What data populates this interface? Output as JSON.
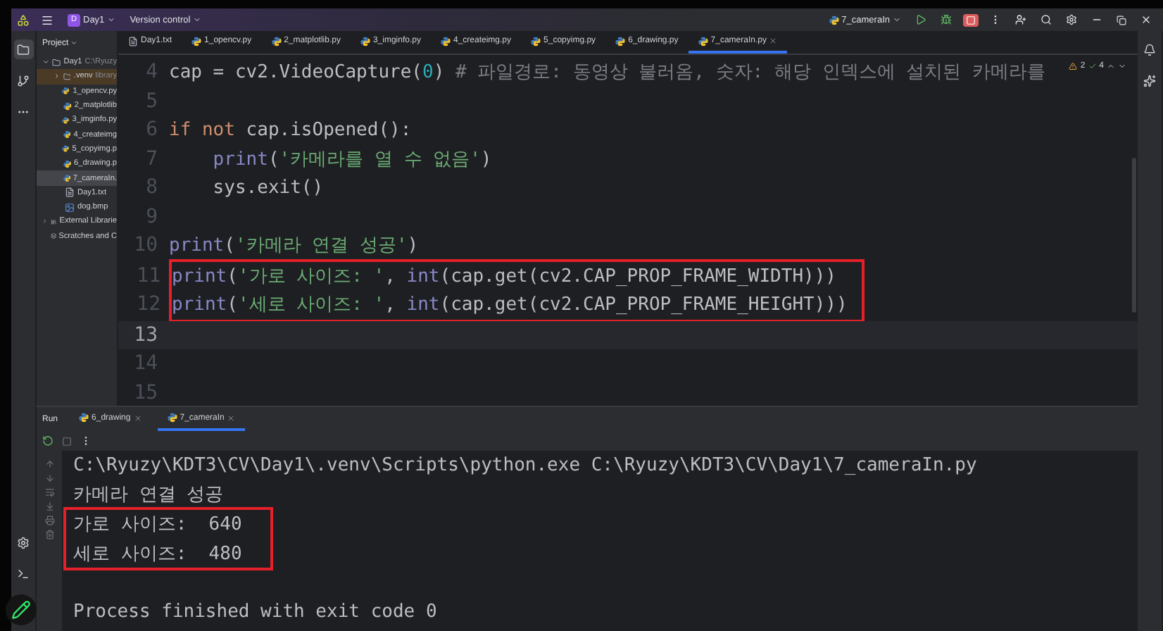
{
  "title_bar": {
    "project_badge": "D",
    "project": "Day1",
    "vcs": "Version control",
    "run_config": "7_cameraIn"
  },
  "project_panel": {
    "title": "Project",
    "tree": [
      {
        "label": "Day1",
        "note": "C:\\Ryuzy",
        "kind": "folder",
        "expanded": true,
        "selected": false,
        "excluded": false,
        "children": [
          {
            "label": ".venv",
            "note": "library",
            "kind": "folder",
            "expanded": false,
            "selected": false,
            "excluded": true
          },
          {
            "label": "1_opencv.py",
            "kind": "python",
            "selected": false,
            "excluded": false
          },
          {
            "label": "2_matplotlib",
            "kind": "python",
            "selected": false,
            "excluded": false
          },
          {
            "label": "3_imginfo.py",
            "kind": "python",
            "selected": false,
            "excluded": false
          },
          {
            "label": "4_createimg",
            "kind": "python",
            "selected": false,
            "excluded": false
          },
          {
            "label": "5_copyimg.p",
            "kind": "python",
            "selected": false,
            "excluded": false
          },
          {
            "label": "6_drawing.p",
            "kind": "python",
            "selected": false,
            "excluded": false
          },
          {
            "label": "7_cameraIn.",
            "kind": "python",
            "selected": true,
            "excluded": false
          },
          {
            "label": "Day1.txt",
            "kind": "text",
            "selected": false,
            "excluded": false
          },
          {
            "label": "dog.bmp",
            "kind": "image",
            "selected": false,
            "excluded": false
          }
        ]
      },
      {
        "label": "External Librarie",
        "kind": "library",
        "expanded": false,
        "selected": false,
        "excluded": false
      },
      {
        "label": "Scratches and C",
        "kind": "scratch",
        "selected": false,
        "excluded": false
      }
    ]
  },
  "editor_tabs": [
    {
      "label": "Day1.txt",
      "kind": "text",
      "selected": false
    },
    {
      "label": "1_opencv.py",
      "kind": "python",
      "selected": false
    },
    {
      "label": "2_matplotlib.py",
      "kind": "python",
      "selected": false
    },
    {
      "label": "3_imginfo.py",
      "kind": "python",
      "selected": false
    },
    {
      "label": "4_createimg.py",
      "kind": "python",
      "selected": false
    },
    {
      "label": "5_copyimg.py",
      "kind": "python",
      "selected": false
    },
    {
      "label": "6_drawing.py",
      "kind": "python",
      "selected": false
    },
    {
      "label": "7_cameraIn.py",
      "kind": "python",
      "selected": true
    }
  ],
  "inspections": {
    "warnings": "2",
    "weak_warnings": "4"
  },
  "code": [
    {
      "number": "4",
      "current": false,
      "boxed": false,
      "tokens": [
        {
          "kind": "plain",
          "text": "cap = cv2.VideoCapture("
        },
        {
          "kind": "number",
          "text": "0"
        },
        {
          "kind": "plain",
          "text": ")"
        },
        {
          "kind": "comment",
          "text": " # 파일경로: 동영상 불러옴, 숫자: 해당 인덱스에 설치된 카메라를"
        }
      ]
    },
    {
      "number": "5",
      "current": false,
      "boxed": false
    },
    {
      "number": "6",
      "current": false,
      "boxed": false,
      "tokens": [
        {
          "kind": "keyword",
          "text": "if not"
        },
        {
          "kind": "plain",
          "text": " cap.isOpened():"
        }
      ]
    },
    {
      "number": "7",
      "current": false,
      "boxed": false,
      "tokens": [
        {
          "kind": "builtin",
          "text": "    print"
        },
        {
          "kind": "plain",
          "text": "("
        },
        {
          "kind": "string",
          "text": "'카메라를 열 수 없음'"
        },
        {
          "kind": "plain",
          "text": ")"
        }
      ]
    },
    {
      "number": "8",
      "current": false,
      "boxed": false,
      "tokens": [
        {
          "kind": "plain",
          "text": "    sys.exit()"
        }
      ]
    },
    {
      "number": "9",
      "current": false,
      "boxed": false
    },
    {
      "number": "10",
      "current": false,
      "boxed": false,
      "tokens": [
        {
          "kind": "builtin",
          "text": "print"
        },
        {
          "kind": "plain",
          "text": "("
        },
        {
          "kind": "string",
          "text": "'카메라 연결 성공'"
        },
        {
          "kind": "plain",
          "text": ")"
        }
      ]
    },
    {
      "number": "11",
      "current": false,
      "boxed": true,
      "tokens": [
        {
          "kind": "builtin",
          "text": "print"
        },
        {
          "kind": "plain",
          "text": "("
        },
        {
          "kind": "string",
          "text": "'가로 사이즈: '"
        },
        {
          "kind": "plain",
          "text": ", "
        },
        {
          "kind": "builtin",
          "text": "int"
        },
        {
          "kind": "plain",
          "text": "(cap.get(cv2.CAP_PROP_FRAME_WIDTH)))"
        }
      ]
    },
    {
      "number": "12",
      "current": false,
      "boxed": true,
      "tokens": [
        {
          "kind": "builtin",
          "text": "print"
        },
        {
          "kind": "plain",
          "text": "("
        },
        {
          "kind": "string",
          "text": "'세로 사이즈: '"
        },
        {
          "kind": "plain",
          "text": ", "
        },
        {
          "kind": "builtin",
          "text": "int"
        },
        {
          "kind": "plain",
          "text": "(cap.get(cv2.CAP_PROP_FRAME_HEIGHT)))"
        }
      ]
    },
    {
      "number": "13",
      "current": true,
      "boxed": false
    },
    {
      "number": "14",
      "current": false,
      "boxed": false
    },
    {
      "number": "15",
      "current": false,
      "boxed": false
    }
  ],
  "run_panel": {
    "title": "Run",
    "tabs": [
      {
        "label": "6_drawing",
        "selected": false
      },
      {
        "label": "7_cameraIn",
        "selected": true
      }
    ],
    "console": [
      {
        "text": "C:\\Ryuzy\\KDT3\\CV\\Day1\\.venv\\Scripts\\python.exe C:\\Ryuzy\\KDT3\\CV\\Day1\\7_cameraIn.py",
        "boxed": false,
        "spaced": false
      },
      {
        "text": "카메라 연결 성공",
        "boxed": false,
        "spaced": false
      },
      {
        "text": "가로 사이즈:  640",
        "boxed": true,
        "spaced": false
      },
      {
        "text": "세로 사이즈:  480",
        "boxed": true,
        "spaced": false
      },
      {
        "text": "Process finished with exit code 0",
        "boxed": false,
        "spaced": true
      }
    ]
  }
}
